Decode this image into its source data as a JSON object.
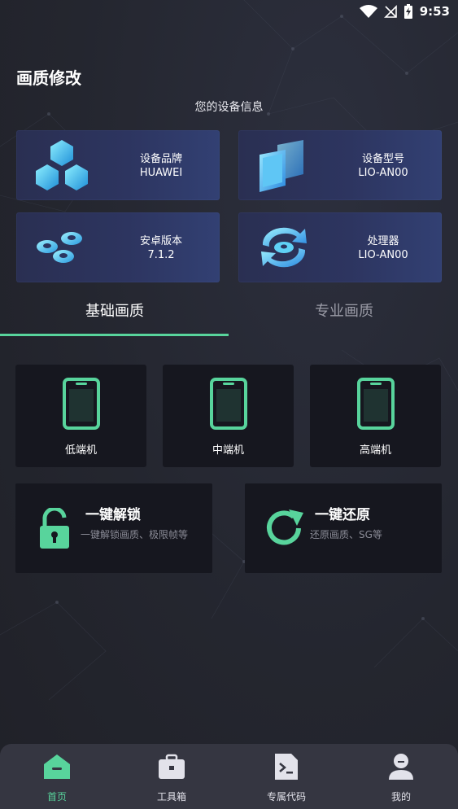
{
  "status_bar": {
    "time": "9:53"
  },
  "page": {
    "title": "画质修改",
    "info_heading": "您的设备信息"
  },
  "device_info": [
    {
      "label": "设备品牌",
      "value": "HUAWEI",
      "icon": "cubes-icon"
    },
    {
      "label": "设备型号",
      "value": "LIO-AN00",
      "icon": "screens-icon"
    },
    {
      "label": "安卓版本",
      "value": "7.1.2",
      "icon": "nuts-icon"
    },
    {
      "label": "处理器",
      "value": "LIO-AN00",
      "icon": "processor-cycle-icon"
    }
  ],
  "tabs": [
    {
      "label": "基础画质",
      "active": true
    },
    {
      "label": "专业画质",
      "active": false
    }
  ],
  "device_levels": [
    {
      "label": "低端机",
      "icon": "phone-icon"
    },
    {
      "label": "中端机",
      "icon": "phone-icon"
    },
    {
      "label": "高端机",
      "icon": "phone-icon"
    }
  ],
  "actions": [
    {
      "title": "一键解锁",
      "subtitle": "一键解锁画质、极限帧等",
      "icon": "unlock-icon"
    },
    {
      "title": "一键还原",
      "subtitle": "还原画质、SG等",
      "icon": "refresh-icon"
    }
  ],
  "bottom_nav": [
    {
      "label": "首页",
      "icon": "home-icon",
      "active": true
    },
    {
      "label": "工具箱",
      "icon": "toolbox-icon",
      "active": false
    },
    {
      "label": "专属代码",
      "icon": "terminal-file-icon",
      "active": false
    },
    {
      "label": "我的",
      "icon": "user-icon",
      "active": false
    }
  ],
  "colors": {
    "accent": "#58d49c",
    "card_bg": "#2d3560",
    "tile_bg": "#16171f",
    "nav_bg": "#353641"
  }
}
